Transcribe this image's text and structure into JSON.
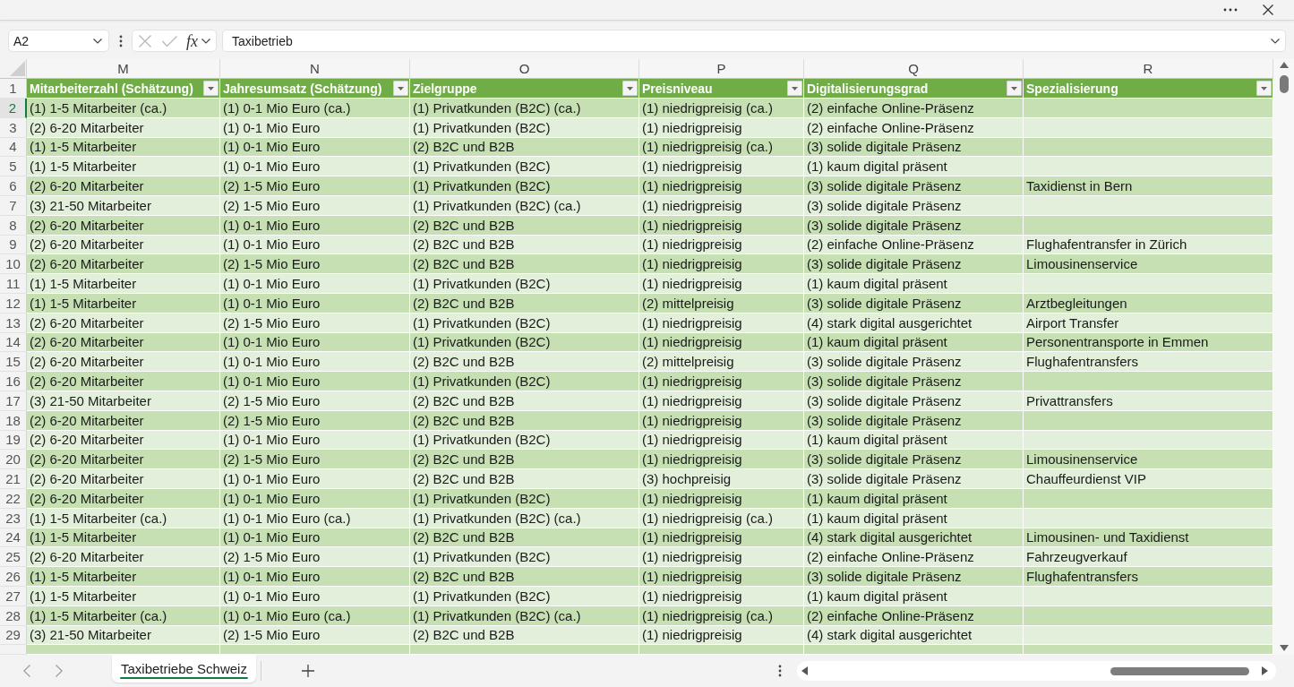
{
  "formula_bar": {
    "name_box": "A2",
    "function_button": "fx",
    "formula": "Taxibetrieb"
  },
  "column_letters": [
    "M",
    "N",
    "O",
    "P",
    "Q",
    "R"
  ],
  "table": {
    "header_row": {
      "number": "1",
      "headings": [
        "Mitarbeiterzahl (Schätzung)",
        "Jahresumsatz (Schätzung)",
        "Zielgruppe",
        "Preisniveau",
        "Digitalisierungsgrad",
        "Spezialisierung"
      ]
    },
    "rows": [
      {
        "number": "2",
        "selected": true,
        "employees": "(1) 1-5 Mitarbeiter (ca.)",
        "revenue": "(1) 0-1 Mio Euro (ca.)",
        "target_group": "(1) Privatkunden (B2C) (ca.)",
        "price_level": "(1) niedrigpreisig (ca.)",
        "digitalization": "(2) einfache Online-Präsenz"
      },
      {
        "number": "3",
        "selected": false,
        "employees": "(2) 6-20 Mitarbeiter",
        "revenue": "(1) 0-1 Mio Euro",
        "target_group": "(1) Privatkunden (B2C)",
        "price_level": "(1) niedrigpreisig",
        "digitalization": "(2) einfache Online-Präsenz"
      },
      {
        "number": "4",
        "selected": false,
        "employees": "(1) 1-5 Mitarbeiter",
        "revenue": "(1) 0-1 Mio Euro",
        "target_group": "(2) B2C und B2B",
        "price_level": "(1) niedrigpreisig (ca.)",
        "digitalization": "(3) solide digitale Präsenz"
      },
      {
        "number": "5",
        "selected": false,
        "employees": "(1) 1-5 Mitarbeiter",
        "revenue": "(1) 0-1 Mio Euro",
        "target_group": "(1) Privatkunden (B2C)",
        "price_level": "(1) niedrigpreisig",
        "digitalization": "(1) kaum digital präsent"
      },
      {
        "number": "6",
        "selected": false,
        "employees": "(2) 6-20 Mitarbeiter",
        "revenue": "(2) 1-5 Mio Euro",
        "target_group": "(1) Privatkunden (B2C)",
        "price_level": "(1) niedrigpreisig",
        "digitalization": "(3) solide digitale Präsenz",
        "specialization": "Taxidienst in Bern"
      },
      {
        "number": "7",
        "selected": false,
        "employees": "(3) 21-50 Mitarbeiter",
        "revenue": "(2) 1-5 Mio Euro",
        "target_group": "(1) Privatkunden (B2C) (ca.)",
        "price_level": "(1) niedrigpreisig",
        "digitalization": "(3) solide digitale Präsenz"
      },
      {
        "number": "8",
        "selected": false,
        "employees": "(2) 6-20 Mitarbeiter",
        "revenue": "(1) 0-1 Mio Euro",
        "target_group": "(2) B2C und B2B",
        "price_level": "(1) niedrigpreisig",
        "digitalization": "(3) solide digitale Präsenz"
      },
      {
        "number": "9",
        "selected": false,
        "employees": "(2) 6-20 Mitarbeiter",
        "revenue": "(1) 0-1 Mio Euro",
        "target_group": "(2) B2C und B2B",
        "price_level": "(1) niedrigpreisig",
        "digitalization": "(2) einfache Online-Präsenz",
        "specialization": "Flughafentransfer in Zürich"
      },
      {
        "number": "10",
        "selected": false,
        "employees": "(2) 6-20 Mitarbeiter",
        "revenue": "(2) 1-5 Mio Euro",
        "target_group": "(2) B2C und B2B",
        "price_level": "(1) niedrigpreisig",
        "digitalization": "(3) solide digitale Präsenz",
        "specialization": "Limousinenservice"
      },
      {
        "number": "11",
        "selected": false,
        "employees": "(1) 1-5 Mitarbeiter",
        "revenue": "(1) 0-1 Mio Euro",
        "target_group": "(1) Privatkunden (B2C)",
        "price_level": "(1) niedrigpreisig",
        "digitalization": "(1) kaum digital präsent"
      },
      {
        "number": "12",
        "selected": false,
        "employees": "(1) 1-5 Mitarbeiter",
        "revenue": "(1) 0-1 Mio Euro",
        "target_group": "(2) B2C und B2B",
        "price_level": "(2) mittelpreisig",
        "digitalization": "(3) solide digitale Präsenz",
        "specialization": "Arztbegleitungen"
      },
      {
        "number": "13",
        "selected": false,
        "employees": "(2) 6-20 Mitarbeiter",
        "revenue": "(2) 1-5 Mio Euro",
        "target_group": "(1) Privatkunden (B2C)",
        "price_level": "(1) niedrigpreisig",
        "digitalization": "(4) stark digital ausgerichtet",
        "specialization": "Airport Transfer"
      },
      {
        "number": "14",
        "selected": false,
        "employees": "(2) 6-20 Mitarbeiter",
        "revenue": "(1) 0-1 Mio Euro",
        "target_group": "(1) Privatkunden (B2C)",
        "price_level": "(1) niedrigpreisig",
        "digitalization": "(1) kaum digital präsent",
        "specialization": "Personentransporte in Emmen"
      },
      {
        "number": "15",
        "selected": false,
        "employees": "(2) 6-20 Mitarbeiter",
        "revenue": "(1) 0-1 Mio Euro",
        "target_group": "(2) B2C und B2B",
        "price_level": "(2) mittelpreisig",
        "digitalization": "(3) solide digitale Präsenz",
        "specialization": "Flughafentransfers"
      },
      {
        "number": "16",
        "selected": false,
        "employees": "(2) 6-20 Mitarbeiter",
        "revenue": "(1) 0-1 Mio Euro",
        "target_group": "(1) Privatkunden (B2C)",
        "price_level": "(1) niedrigpreisig",
        "digitalization": "(3) solide digitale Präsenz"
      },
      {
        "number": "17",
        "selected": false,
        "employees": "(3) 21-50 Mitarbeiter",
        "revenue": "(2) 1-5 Mio Euro",
        "target_group": "(2) B2C und B2B",
        "price_level": "(1) niedrigpreisig",
        "digitalization": "(3) solide digitale Präsenz",
        "specialization": "Privattransfers"
      },
      {
        "number": "18",
        "selected": false,
        "employees": "(2) 6-20 Mitarbeiter",
        "revenue": "(2) 1-5 Mio Euro",
        "target_group": "(2) B2C und B2B",
        "price_level": "(1) niedrigpreisig",
        "digitalization": "(3) solide digitale Präsenz"
      },
      {
        "number": "19",
        "selected": false,
        "employees": "(2) 6-20 Mitarbeiter",
        "revenue": "(1) 0-1 Mio Euro",
        "target_group": "(1) Privatkunden (B2C)",
        "price_level": "(1) niedrigpreisig",
        "digitalization": "(1) kaum digital präsent"
      },
      {
        "number": "20",
        "selected": false,
        "employees": "(2) 6-20 Mitarbeiter",
        "revenue": "(2) 1-5 Mio Euro",
        "target_group": "(2) B2C und B2B",
        "price_level": "(1) niedrigpreisig",
        "digitalization": "(3) solide digitale Präsenz",
        "specialization": "Limousinenservice"
      },
      {
        "number": "21",
        "selected": false,
        "employees": "(2) 6-20 Mitarbeiter",
        "revenue": "(1) 0-1 Mio Euro",
        "target_group": "(2) B2C und B2B",
        "price_level": "(3) hochpreisig",
        "digitalization": "(3) solide digitale Präsenz",
        "specialization": "Chauffeurdienst VIP"
      },
      {
        "number": "22",
        "selected": false,
        "employees": "(2) 6-20 Mitarbeiter",
        "revenue": "(1) 0-1 Mio Euro",
        "target_group": "(1) Privatkunden (B2C)",
        "price_level": "(1) niedrigpreisig",
        "digitalization": "(1) kaum digital präsent"
      },
      {
        "number": "23",
        "selected": false,
        "employees": "(1) 1-5 Mitarbeiter (ca.)",
        "revenue": "(1) 0-1 Mio Euro (ca.)",
        "target_group": "(1) Privatkunden (B2C) (ca.)",
        "price_level": "(1) niedrigpreisig (ca.)",
        "digitalization": "(1) kaum digital präsent"
      },
      {
        "number": "24",
        "selected": false,
        "employees": "(1) 1-5 Mitarbeiter",
        "revenue": "(1) 0-1 Mio Euro",
        "target_group": "(2) B2C und B2B",
        "price_level": "(1) niedrigpreisig",
        "digitalization": "(4) stark digital ausgerichtet",
        "specialization": "Limousinen- und Taxidienst"
      },
      {
        "number": "25",
        "selected": false,
        "employees": "(2) 6-20 Mitarbeiter",
        "revenue": "(2) 1-5 Mio Euro",
        "target_group": "(1) Privatkunden (B2C)",
        "price_level": "(1) niedrigpreisig",
        "digitalization": "(2) einfache Online-Präsenz",
        "specialization": "Fahrzeugverkauf"
      },
      {
        "number": "26",
        "selected": false,
        "employees": "(1) 1-5 Mitarbeiter",
        "revenue": "(1) 0-1 Mio Euro",
        "target_group": "(2) B2C und B2B",
        "price_level": "(1) niedrigpreisig",
        "digitalization": "(3) solide digitale Präsenz",
        "specialization": "Flughafentransfers"
      },
      {
        "number": "27",
        "selected": false,
        "employees": "(1) 1-5 Mitarbeiter",
        "revenue": "(1) 0-1 Mio Euro",
        "target_group": "(1) Privatkunden (B2C)",
        "price_level": "(1) niedrigpreisig",
        "digitalization": "(1) kaum digital präsent"
      },
      {
        "number": "28",
        "selected": false,
        "employees": "(1) 1-5 Mitarbeiter (ca.)",
        "revenue": "(1) 0-1 Mio Euro (ca.)",
        "target_group": "(1) Privatkunden (B2C) (ca.)",
        "price_level": "(1) niedrigpreisig (ca.)",
        "digitalization": "(2) einfache Online-Präsenz"
      },
      {
        "number": "29",
        "selected": false,
        "employees": "(3) 21-50 Mitarbeiter",
        "revenue": "(2) 1-5 Mio Euro",
        "target_group": "(2) B2C und B2B",
        "price_level": "(1) niedrigpreisig",
        "digitalization": "(4) stark digital ausgerichtet"
      }
    ]
  },
  "sheet_tabs": [
    {
      "label": "Taxibetriebe Schweiz",
      "selected": true
    }
  ]
}
